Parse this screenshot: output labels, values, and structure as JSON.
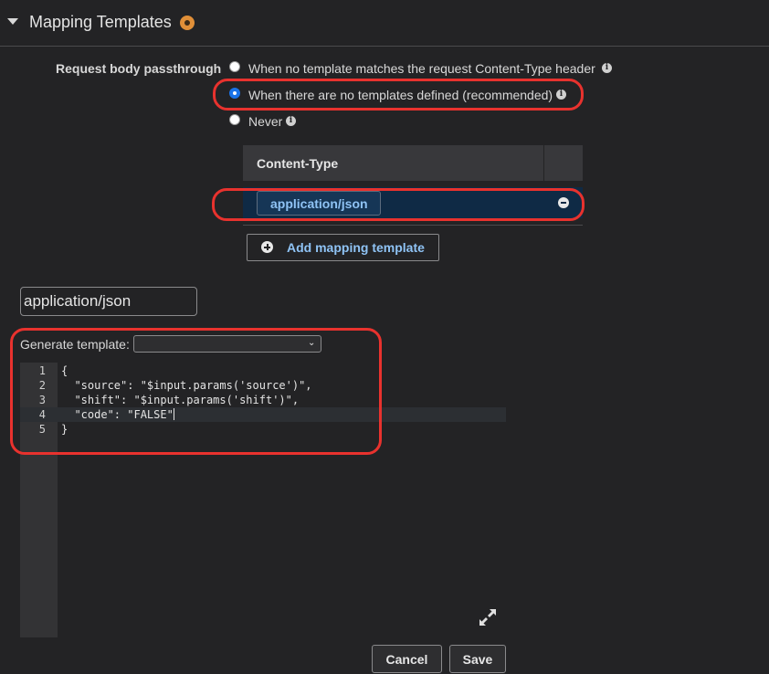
{
  "section": {
    "title": "Mapping Templates",
    "collapse_icon": "caret-down-icon",
    "status_icon": "warning-dot-icon",
    "status_color": "#e08f38"
  },
  "passthrough": {
    "label": "Request body passthrough",
    "options": [
      {
        "label": "When no template matches the request Content-Type header",
        "checked": false
      },
      {
        "label": "When there are no templates defined (recommended)",
        "checked": true
      },
      {
        "label": "Never",
        "checked": false
      }
    ],
    "info_glyph": "i"
  },
  "content_types": {
    "header": "Content-Type",
    "rows": [
      {
        "value": "application/json"
      }
    ],
    "add_label": "Add mapping template"
  },
  "editor": {
    "content_type_value": "application/json",
    "generate_label": "Generate template:",
    "generate_selected": "",
    "line_numbers": [
      "1",
      "2",
      "3",
      "4",
      "5"
    ],
    "lines": [
      "{",
      "  \"source\": \"$input.params('source')\",",
      "  \"shift\": \"$input.params('shift')\",",
      "  \"code\": \"FALSE\"",
      "}"
    ],
    "active_line": 4
  },
  "footer": {
    "cancel_label": "Cancel",
    "save_label": "Save"
  },
  "colors": {
    "background": "#232325",
    "accent_link": "#8fc3f5",
    "radio_checked": "#1a73e8",
    "highlight": "#e8322e",
    "selected_row": "#0f2a45"
  }
}
